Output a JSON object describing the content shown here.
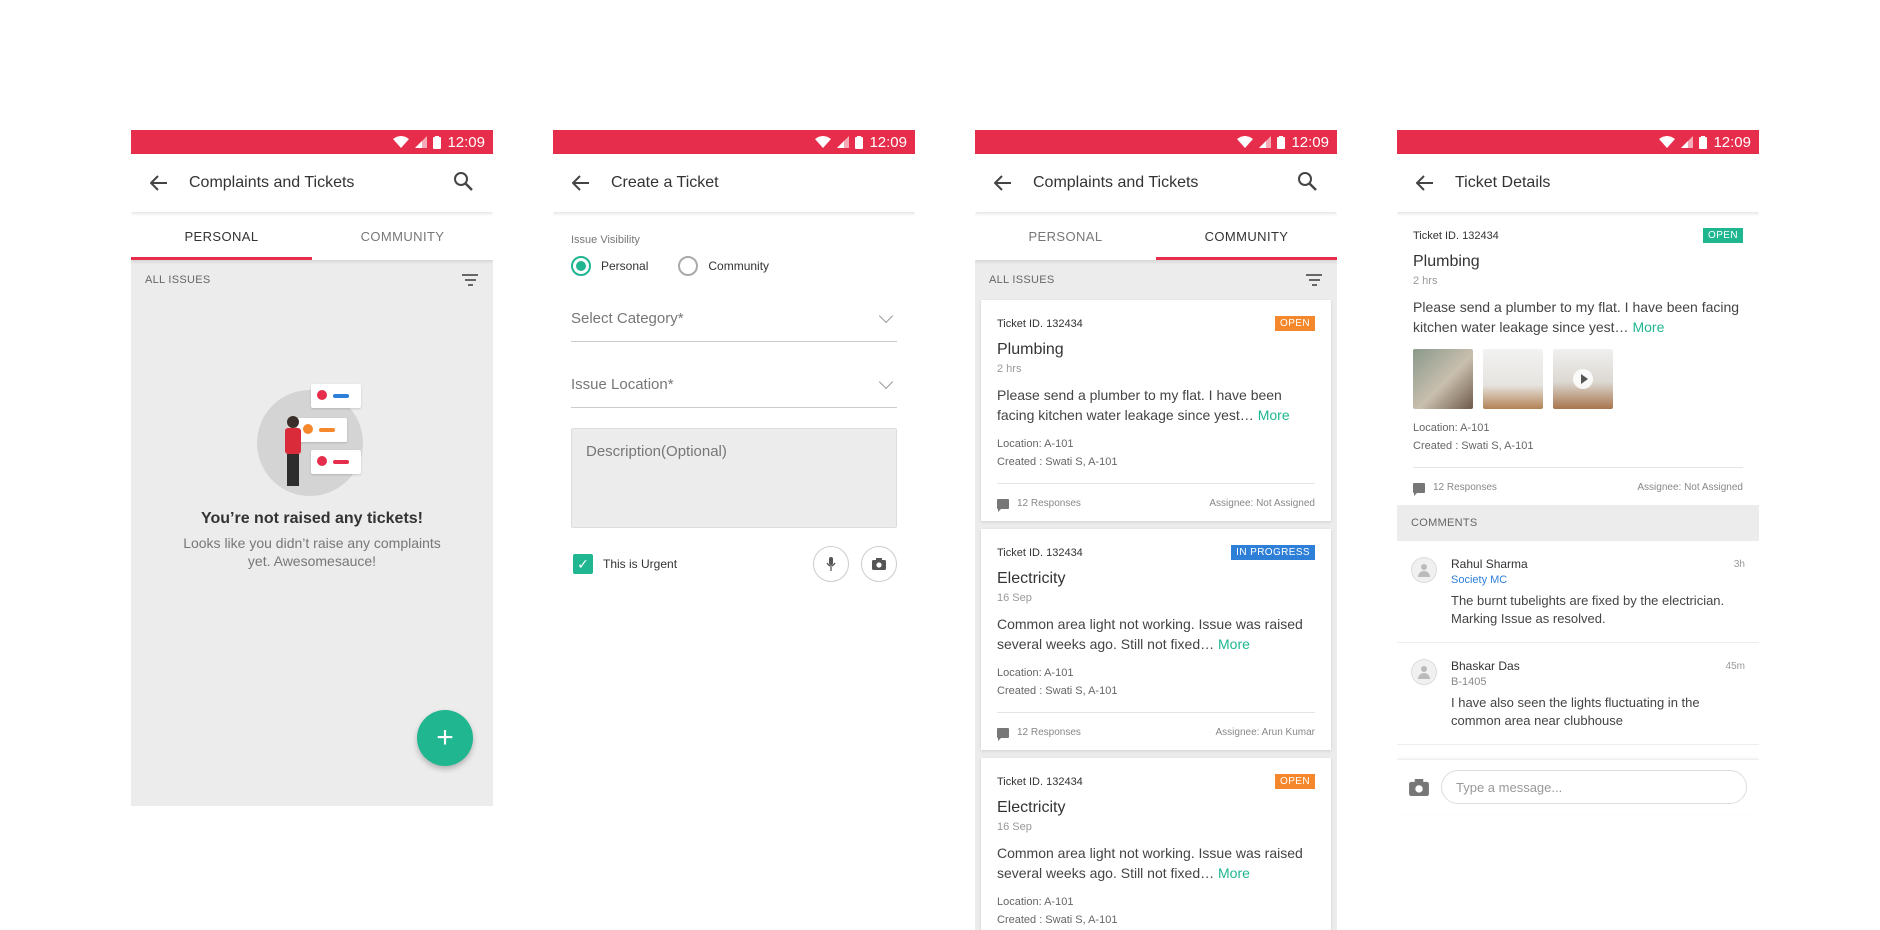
{
  "status": {
    "time": "12:09"
  },
  "screen1": {
    "title": "Complaints and Tickets",
    "tabs": [
      "PERSONAL",
      "COMMUNITY"
    ],
    "filter_label": "ALL ISSUES",
    "empty_title": "You’re not raised any tickets!",
    "empty_text": "Looks like you didn’t raise any complaints yet. Awesomesauce!",
    "fab": "+"
  },
  "screen2": {
    "title": "Create a Ticket",
    "visibility_label": "Issue Visibility",
    "visibility_options": [
      "Personal",
      "Community"
    ],
    "visibility_selected": "Personal",
    "category_placeholder": "Select Category*",
    "location_placeholder": "Issue Location*",
    "description_placeholder": "Description(Optional)",
    "urgent_label": "This is Urgent",
    "urgent_checked": true
  },
  "screen3": {
    "title": "Complaints and Tickets",
    "tabs": [
      "PERSONAL",
      "COMMUNITY"
    ],
    "filter_label": "ALL ISSUES",
    "tickets": [
      {
        "id": "Ticket ID. 132434",
        "status": "OPEN",
        "title": "Plumbing",
        "time": "2 hrs",
        "body": "Please send a plumber to my flat. I have been facing kitchen water leakage since yest…",
        "more": "More",
        "location": "Location: A-101",
        "created": "Created : Swati S, A-101",
        "responses": "12 Responses",
        "assignee": "Assignee: Not Assigned"
      },
      {
        "id": "Ticket ID. 132434",
        "status": "IN PROGRESS",
        "title": "Electricity",
        "time": "16 Sep",
        "body": "Common area light not working. Issue was raised several weeks ago. Still not fixed…",
        "more": "More",
        "location": "Location: A-101",
        "created": "Created : Swati S, A-101",
        "responses": "12 Responses",
        "assignee": "Assignee: Arun Kumar"
      },
      {
        "id": "Ticket ID. 132434",
        "status": "OPEN",
        "title": "Electricity",
        "time": "16 Sep",
        "body": "Common area light not working. Issue was raised several weeks ago. Still not fixed…",
        "more": "More",
        "location": "Location: A-101",
        "created": "Created : Swati S, A-101"
      }
    ]
  },
  "screen4": {
    "title": "Ticket Details",
    "ticket": {
      "id": "Ticket ID. 132434",
      "status": "OPEN",
      "title": "Plumbing",
      "time": "2 hrs",
      "body": "Please send a plumber to my flat. I have been facing kitchen water leakage since yest…",
      "more": "More",
      "location": "Location: A-101",
      "created": "Created : Swati S, A-101",
      "responses": "12 Responses",
      "assignee": "Assignee: Not Assigned"
    },
    "comments_header": "COMMENTS",
    "comments": [
      {
        "name": "Rahul Sharma",
        "role": "Society MC",
        "time": "3h",
        "text": "The burnt tubelights are fixed by the electrician. Marking Issue as resolved."
      },
      {
        "name": "Bhaskar Das",
        "role": "B-1405",
        "time": "45m",
        "text": "I have also seen the lights fluctuating in the common area near clubhouse"
      }
    ],
    "message_placeholder": "Type a message..."
  },
  "colors": {
    "brand": "#e62d4b",
    "accent": "#1fb690",
    "open": "#f5872c",
    "in_progress": "#2e7fd8"
  }
}
